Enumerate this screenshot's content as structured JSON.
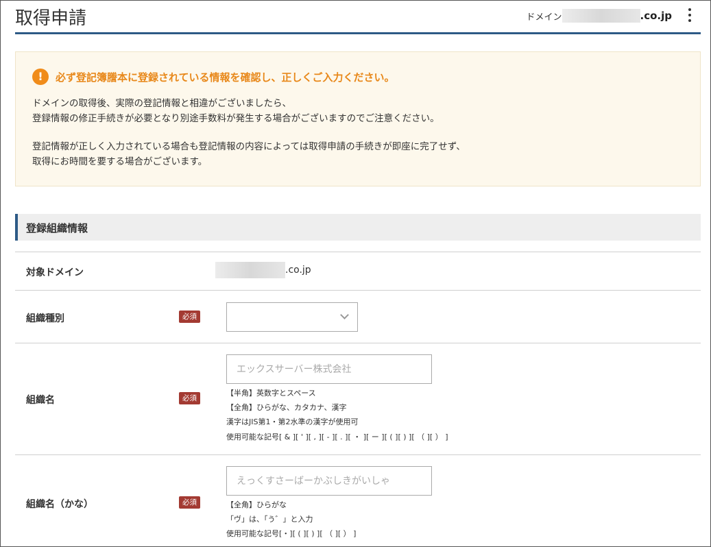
{
  "header": {
    "title": "取得申請",
    "domain_label": "ドメイン",
    "domain_suffix": ".co.jp",
    "menu_icon": "kebab-menu-icon"
  },
  "notice": {
    "icon": "exclamation-icon",
    "title": "必ず登記簿謄本に登録されている情報を確認し、正しくご入力ください。",
    "p1_line1": "ドメインの取得後、実際の登記情報と相違がございましたら、",
    "p1_line2": "登録情報の修正手続きが必要となり別途手数料が発生する場合がございますのでご注意ください。",
    "p2_line1": "登記情報が正しく入力されている場合も登記情報の内容によっては取得申請の手続きが即座に完了せず、",
    "p2_line2": "取得にお時間を要する場合がございます。"
  },
  "section": {
    "title": "登録組織情報"
  },
  "form": {
    "required_badge": "必須",
    "target_domain": {
      "label": "対象ドメイン",
      "value_suffix": ".co.jp"
    },
    "org_type": {
      "label": "組織種別",
      "value": ""
    },
    "org_name": {
      "label": "組織名",
      "placeholder": "エックスサーバー株式会社",
      "hints": [
        "【半角】英数字とスペース",
        "【全角】ひらがな、カタカナ、漢字",
        "漢字はJIS第1・第2水準の漢字が使用可",
        "使用可能な記号[ & ][ ' ][ , ][ - ][ . ][ ・ ][ ー ][ ( ][ ) ][ （ ][ ） ]"
      ]
    },
    "org_name_kana": {
      "label": "組織名（かな）",
      "placeholder": "えっくすさーばーかぶしきがいしゃ",
      "hints": [
        "【全角】ひらがな",
        "「ヴ」は、「う゛」と入力",
        "使用可能な記号[・][ ( ][ ) ][ （ ][ ） ]"
      ]
    }
  }
}
